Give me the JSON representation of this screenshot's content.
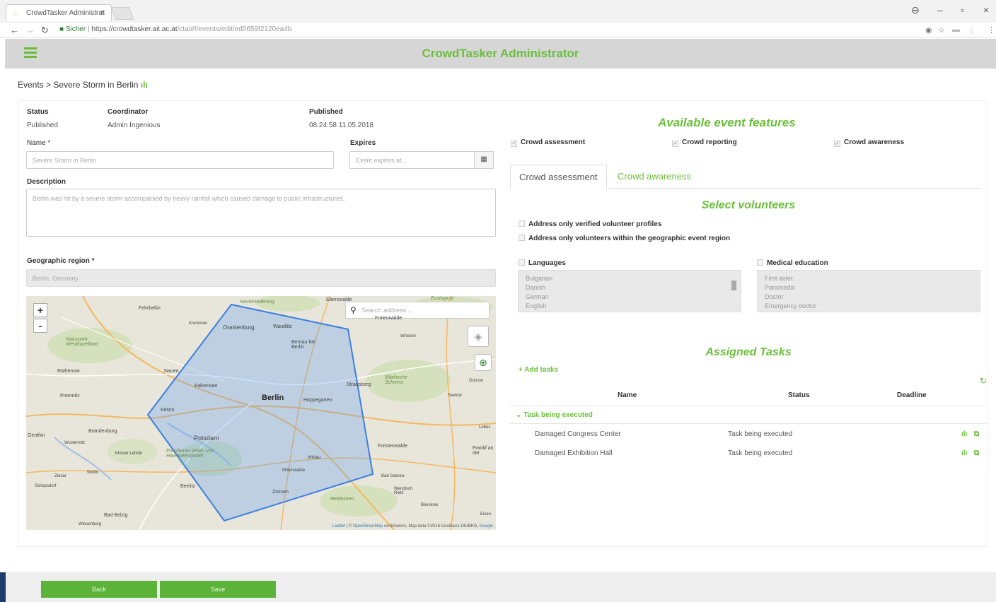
{
  "browser": {
    "tab_title": "CrowdTasker Administrat",
    "url_secure": "Sicher",
    "url_host": "https://crowdtasker.ait.ac.at",
    "url_path": "/cta/#!/events/edit/ed0659f2120ea4b"
  },
  "app": {
    "title": "CrowdTasker Administrator"
  },
  "breadcrumb": {
    "root": "Events",
    "separator": ">",
    "current": "Severe Storm in Berlin"
  },
  "event": {
    "status_label": "Status",
    "status_value": "Published",
    "coordinator_label": "Coordinator",
    "coordinator_value": "Admin Ingenious",
    "published_label": "Published",
    "published_value": "08:24:58 11.05.2018",
    "name_label": "Name *",
    "name_value": "Severe Storm in Berlin",
    "expires_label": "Expires",
    "expires_placeholder": "Event expires at...",
    "description_label": "Description",
    "description_value": "Berlin was hit by a severe storm accompanied by heavy rainfall which caused damage to public infrastructures.",
    "region_label": "Geographic region *",
    "region_value": "Berlin, Germany"
  },
  "map": {
    "search_placeholder": "Search address ...",
    "zoom_in": "+",
    "zoom_out": "-",
    "attribution_leaflet": "Leaflet",
    "attribution_osm": "OpenStreetMap",
    "attribution_rest": "contributors, Map data ©2016 GeoBasis-DE/BKG,",
    "attribution_google": "Google",
    "labels": {
      "berlin": "Berlin",
      "potsdam": "Potsdam",
      "oranienburg": "Oranienburg",
      "bernau": "Bernau bei Berlin",
      "eberswalde": "Eberswalde",
      "brandenburg": "Brandenburg",
      "strausberg": "Strausberg",
      "furstenwalde": "Fürstenwalde",
      "falkensee": "Falkensee",
      "hoppegarten": "Hoppegarten",
      "nauen": "Nauen",
      "zossen": "Zossen",
      "ketzin": "Ketzin",
      "fehrbellin": "Fehrbellin",
      "kremmen": "Kremmen",
      "wandlitz": "Wandlitz",
      "rathenow": "Rathenow",
      "premnitz": "Premnitz",
      "beelitz": "Beelitz",
      "bad_belzig": "Bad Belzig",
      "naturpark": "Naturpark Westhavelland",
      "markische": "Märkische Schweiz",
      "havelniederung": "Havelniederung",
      "ecological": "Ecological",
      "freienwalde": "Freienwalde",
      "potsdamer_wald": "Potsdamer Wald- und Havelseengebiet",
      "mittenwalde": "Mittenwalde",
      "heideseen": "Heideseen",
      "frankfurt": "Frankf an der",
      "genthin": "Genthin",
      "ziesar": "Ziesar",
      "wusterwitz": "Wusterwitz",
      "kloster_lehnin": "Kloster Lehnin",
      "wriezen": "Wriezen",
      "seelow": "Seelow",
      "gusow": "Golzow",
      "lebus": "Lebus",
      "beeskow": "Beeskow",
      "bad_saarow": "Bad Saarow",
      "wendisch": "Wendisch Rietz",
      "schopsdorf": "Schopsdorf",
      "wiesenburg": "Wiesenburg",
      "wildau": "Wildau",
      "eisen": "Eisen",
      "wollin": "Wollin"
    }
  },
  "features": {
    "title": "Available event features",
    "items": [
      {
        "label": "Crowd assessment",
        "checked": true
      },
      {
        "label": "Crowd reporting",
        "checked": true
      },
      {
        "label": "Crowd awareness",
        "checked": true
      }
    ]
  },
  "tabs": [
    {
      "label": "Crowd assessment",
      "active": true
    },
    {
      "label": "Crowd awareness",
      "active": false
    }
  ],
  "volunteers": {
    "title": "Select volunteers",
    "verified_label": "Address only verified volunteer profiles",
    "region_label": "Address only volunteers within the geographic event region",
    "languages_label": "Languages",
    "languages": [
      "Bulgarian",
      "Danish",
      "German",
      "English"
    ],
    "medical_label": "Medical education",
    "medical": [
      "First aider",
      "Paramedic",
      "Doctor",
      "Emergency doctor"
    ]
  },
  "tasks": {
    "title": "Assigned Tasks",
    "add_label": "Add tasks",
    "columns": {
      "name": "Name",
      "status": "Status",
      "deadline": "Deadline"
    },
    "group_label": "Task being executed",
    "rows": [
      {
        "name": "Damaged Congress Center",
        "status": "Task being executed"
      },
      {
        "name": "Damaged Exhibition Hall",
        "status": "Task being executed"
      }
    ]
  },
  "footer": {
    "back_label": "Back",
    "save_label": "Save"
  },
  "colors": {
    "accent": "#6abf3a",
    "button": "#5cb33a",
    "polygon": "#3d7fe0"
  }
}
